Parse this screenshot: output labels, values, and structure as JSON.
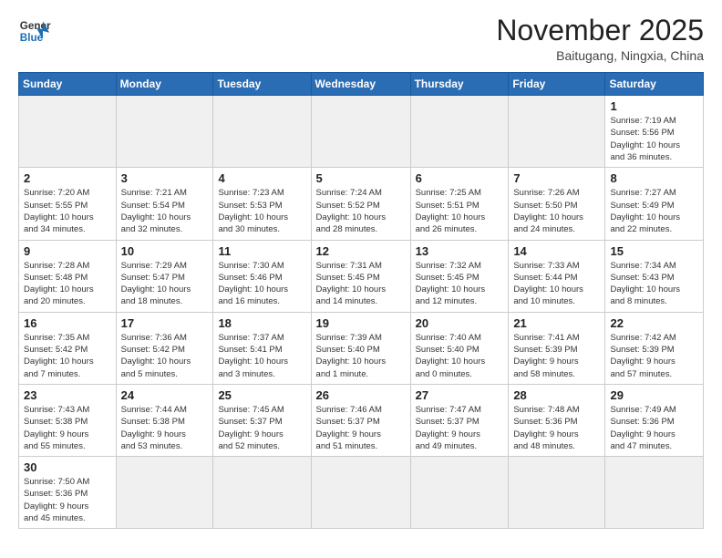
{
  "logo": {
    "line1": "General",
    "line2": "Blue"
  },
  "title": "November 2025",
  "location": "Baitugang, Ningxia, China",
  "weekdays": [
    "Sunday",
    "Monday",
    "Tuesday",
    "Wednesday",
    "Thursday",
    "Friday",
    "Saturday"
  ],
  "days": [
    {
      "num": "",
      "info": ""
    },
    {
      "num": "",
      "info": ""
    },
    {
      "num": "",
      "info": ""
    },
    {
      "num": "",
      "info": ""
    },
    {
      "num": "",
      "info": ""
    },
    {
      "num": "",
      "info": ""
    },
    {
      "num": "1",
      "info": "Sunrise: 7:19 AM\nSunset: 5:56 PM\nDaylight: 10 hours\nand 36 minutes."
    },
    {
      "num": "2",
      "info": "Sunrise: 7:20 AM\nSunset: 5:55 PM\nDaylight: 10 hours\nand 34 minutes."
    },
    {
      "num": "3",
      "info": "Sunrise: 7:21 AM\nSunset: 5:54 PM\nDaylight: 10 hours\nand 32 minutes."
    },
    {
      "num": "4",
      "info": "Sunrise: 7:23 AM\nSunset: 5:53 PM\nDaylight: 10 hours\nand 30 minutes."
    },
    {
      "num": "5",
      "info": "Sunrise: 7:24 AM\nSunset: 5:52 PM\nDaylight: 10 hours\nand 28 minutes."
    },
    {
      "num": "6",
      "info": "Sunrise: 7:25 AM\nSunset: 5:51 PM\nDaylight: 10 hours\nand 26 minutes."
    },
    {
      "num": "7",
      "info": "Sunrise: 7:26 AM\nSunset: 5:50 PM\nDaylight: 10 hours\nand 24 minutes."
    },
    {
      "num": "8",
      "info": "Sunrise: 7:27 AM\nSunset: 5:49 PM\nDaylight: 10 hours\nand 22 minutes."
    },
    {
      "num": "9",
      "info": "Sunrise: 7:28 AM\nSunset: 5:48 PM\nDaylight: 10 hours\nand 20 minutes."
    },
    {
      "num": "10",
      "info": "Sunrise: 7:29 AM\nSunset: 5:47 PM\nDaylight: 10 hours\nand 18 minutes."
    },
    {
      "num": "11",
      "info": "Sunrise: 7:30 AM\nSunset: 5:46 PM\nDaylight: 10 hours\nand 16 minutes."
    },
    {
      "num": "12",
      "info": "Sunrise: 7:31 AM\nSunset: 5:45 PM\nDaylight: 10 hours\nand 14 minutes."
    },
    {
      "num": "13",
      "info": "Sunrise: 7:32 AM\nSunset: 5:45 PM\nDaylight: 10 hours\nand 12 minutes."
    },
    {
      "num": "14",
      "info": "Sunrise: 7:33 AM\nSunset: 5:44 PM\nDaylight: 10 hours\nand 10 minutes."
    },
    {
      "num": "15",
      "info": "Sunrise: 7:34 AM\nSunset: 5:43 PM\nDaylight: 10 hours\nand 8 minutes."
    },
    {
      "num": "16",
      "info": "Sunrise: 7:35 AM\nSunset: 5:42 PM\nDaylight: 10 hours\nand 7 minutes."
    },
    {
      "num": "17",
      "info": "Sunrise: 7:36 AM\nSunset: 5:42 PM\nDaylight: 10 hours\nand 5 minutes."
    },
    {
      "num": "18",
      "info": "Sunrise: 7:37 AM\nSunset: 5:41 PM\nDaylight: 10 hours\nand 3 minutes."
    },
    {
      "num": "19",
      "info": "Sunrise: 7:39 AM\nSunset: 5:40 PM\nDaylight: 10 hours\nand 1 minute."
    },
    {
      "num": "20",
      "info": "Sunrise: 7:40 AM\nSunset: 5:40 PM\nDaylight: 10 hours\nand 0 minutes."
    },
    {
      "num": "21",
      "info": "Sunrise: 7:41 AM\nSunset: 5:39 PM\nDaylight: 9 hours\nand 58 minutes."
    },
    {
      "num": "22",
      "info": "Sunrise: 7:42 AM\nSunset: 5:39 PM\nDaylight: 9 hours\nand 57 minutes."
    },
    {
      "num": "23",
      "info": "Sunrise: 7:43 AM\nSunset: 5:38 PM\nDaylight: 9 hours\nand 55 minutes."
    },
    {
      "num": "24",
      "info": "Sunrise: 7:44 AM\nSunset: 5:38 PM\nDaylight: 9 hours\nand 53 minutes."
    },
    {
      "num": "25",
      "info": "Sunrise: 7:45 AM\nSunset: 5:37 PM\nDaylight: 9 hours\nand 52 minutes."
    },
    {
      "num": "26",
      "info": "Sunrise: 7:46 AM\nSunset: 5:37 PM\nDaylight: 9 hours\nand 51 minutes."
    },
    {
      "num": "27",
      "info": "Sunrise: 7:47 AM\nSunset: 5:37 PM\nDaylight: 9 hours\nand 49 minutes."
    },
    {
      "num": "28",
      "info": "Sunrise: 7:48 AM\nSunset: 5:36 PM\nDaylight: 9 hours\nand 48 minutes."
    },
    {
      "num": "29",
      "info": "Sunrise: 7:49 AM\nSunset: 5:36 PM\nDaylight: 9 hours\nand 47 minutes."
    },
    {
      "num": "30",
      "info": "Sunrise: 7:50 AM\nSunset: 5:36 PM\nDaylight: 9 hours\nand 45 minutes."
    },
    {
      "num": "",
      "info": ""
    },
    {
      "num": "",
      "info": ""
    },
    {
      "num": "",
      "info": ""
    },
    {
      "num": "",
      "info": ""
    },
    {
      "num": "",
      "info": ""
    },
    {
      "num": "",
      "info": ""
    }
  ]
}
